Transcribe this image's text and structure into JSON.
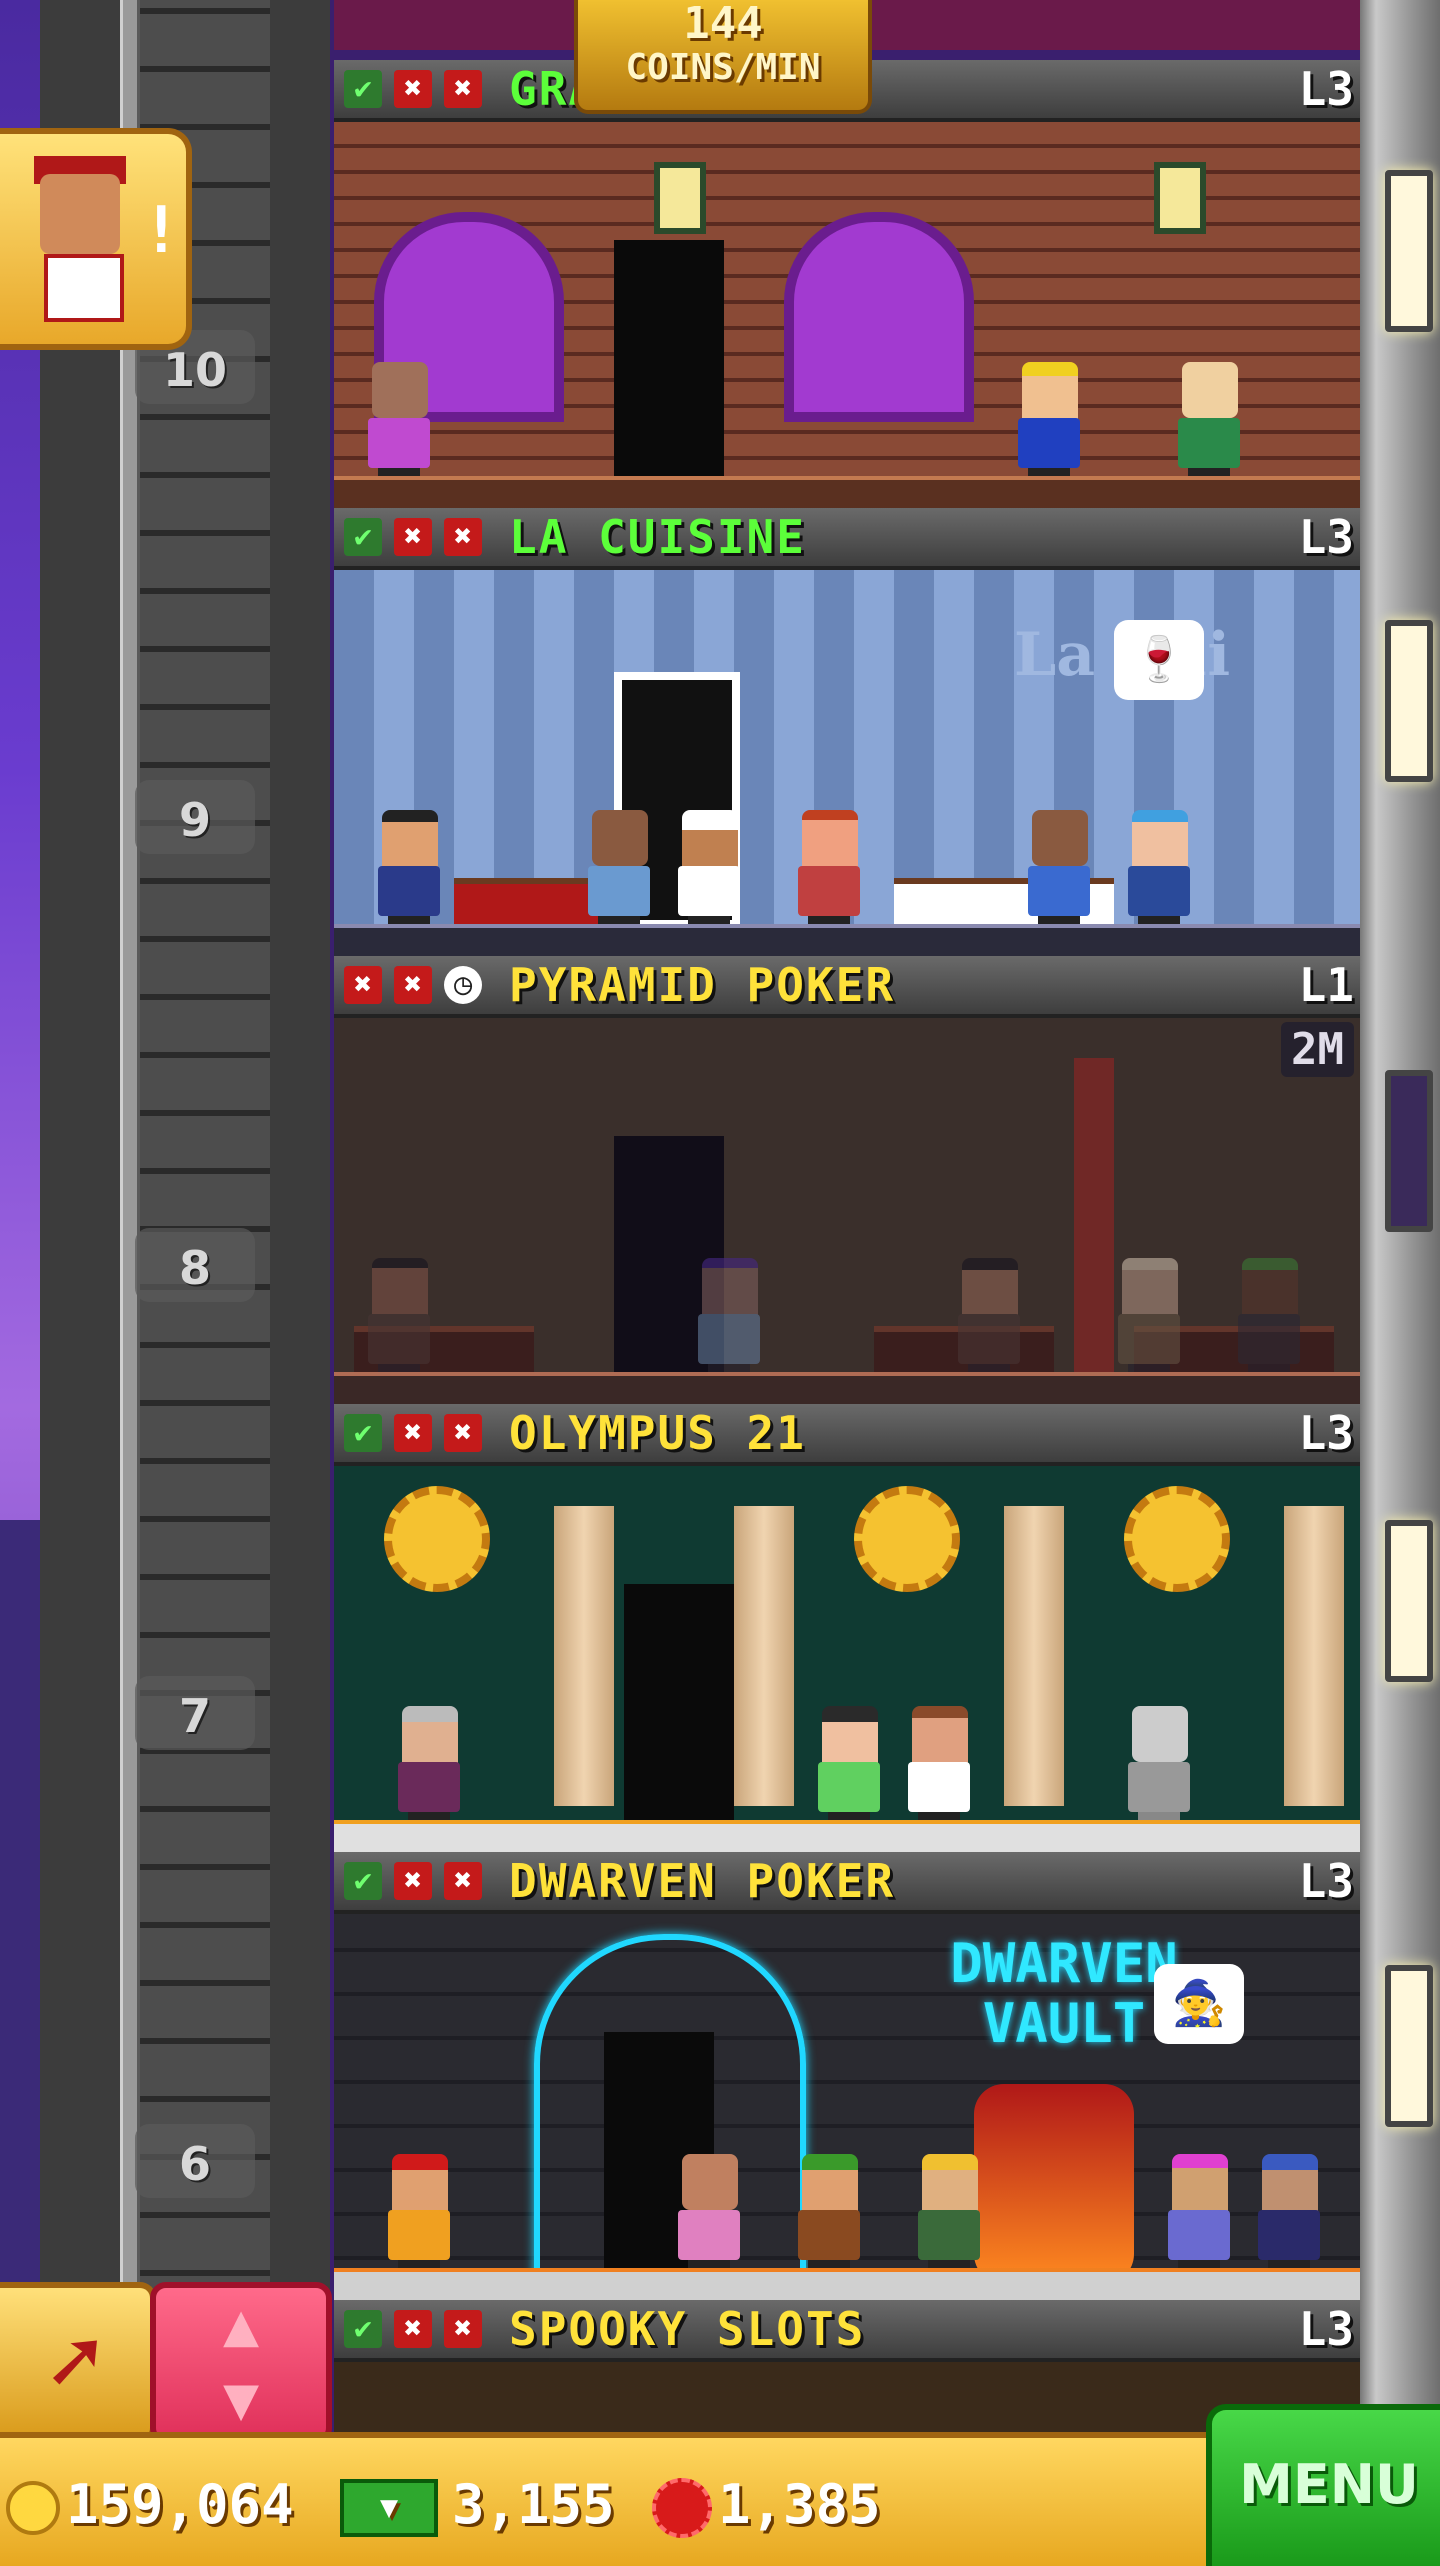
{
  "coins_per_min": {
    "value": "144",
    "unit": "COINS/MIN"
  },
  "floors": [
    {
      "number": "10",
      "name": "GRAPE CELLAR",
      "name_color": "#5cff3a",
      "level": "L3",
      "status": [
        "check",
        "x",
        "x"
      ]
    },
    {
      "number": "9",
      "name": "LA CUISINE",
      "name_color": "#5cff3a",
      "level": "L3",
      "status": [
        "check",
        "x",
        "x"
      ]
    },
    {
      "number": "8",
      "name": "PYRAMID POKER",
      "name_color": "#ffe23a",
      "level": "L1",
      "status": [
        "x",
        "x",
        "clock"
      ],
      "timer": "2M"
    },
    {
      "number": "7",
      "name": "OLYMPUS 21",
      "name_color": "#ffe23a",
      "level": "L3",
      "status": [
        "check",
        "x",
        "x"
      ]
    },
    {
      "number": "6",
      "name": "DWARVEN POKER",
      "name_color": "#ffe23a",
      "level": "L3",
      "status": [
        "check",
        "x",
        "x"
      ]
    },
    {
      "number": "",
      "name": "SPOOKY SLOTS",
      "name_color": "#ffe23a",
      "level": "L3",
      "status": [
        "check",
        "x",
        "x"
      ]
    }
  ],
  "scene_text": {
    "cuisine_sign": "La Cui",
    "dwarven_sign": "DWARVEN VAULT"
  },
  "currency": {
    "coins": "159,064",
    "bux": "3,155",
    "gems": "1,385"
  },
  "menu_label": "MENU",
  "icons": {
    "rocket": "rocket-icon",
    "elevator": "elevator-arrows-icon",
    "bellhop": "bellhop-icon"
  }
}
